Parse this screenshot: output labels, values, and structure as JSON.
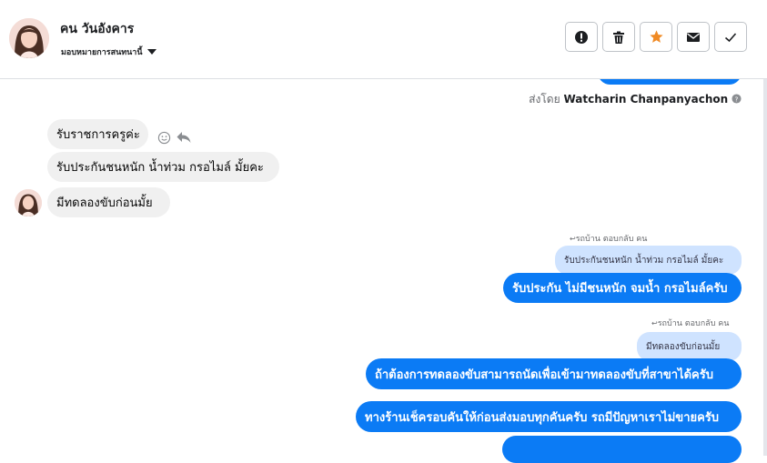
{
  "header": {
    "name": "คน วันอังคาร",
    "assign_label": "มอบหมายการสนทนานี้"
  },
  "actions": [
    {
      "icon": "alert-icon",
      "label": "Report"
    },
    {
      "icon": "trash-icon",
      "label": "Delete"
    },
    {
      "icon": "star-icon",
      "label": "Star"
    },
    {
      "icon": "envelope-icon",
      "label": "Mark unread"
    },
    {
      "icon": "check-icon",
      "label": "Done"
    }
  ],
  "sent_by": {
    "prefix": "ส่งโดย",
    "name": "Watcharin Chanpanyachon"
  },
  "messages": {
    "in1": "รับราชการครูค่ะ",
    "in2": "รับประกันชนหนัก น้ำท่วม กรอไมล์ มั้ยคะ",
    "in3": "มีทดลองขับก่อนมั้ย",
    "reply1_label": "รถบ้าน ตอบกลับ คน",
    "reply1_quote": "รับประกันชนหนัก น้ำท่วม กรอไมล์ มั้ยคะ",
    "out1": "รับประกัน ไม่มีชนหนัก จมน้ำ กรอไมล์ครับ",
    "reply2_label": "รถบ้าน ตอบกลับ คน",
    "reply2_quote": "มีทดลองขับก่อนมั้ย",
    "out2": "ถ้าต้องการทดลองขับสามารถนัดเพื่อเข้ามาทดลองขับที่สาขาได้ครับ",
    "out3": "ทางร้านเช็ครอบคันให้ก่อนส่งมอบทุกคันครับ รถมีปัญหาเราไม่ขายครับ"
  },
  "colors": {
    "outgoing": "#0b7bf5",
    "incoming": "#f0f0f0",
    "quote": "#cfe3ff",
    "star": "#f08a24"
  }
}
